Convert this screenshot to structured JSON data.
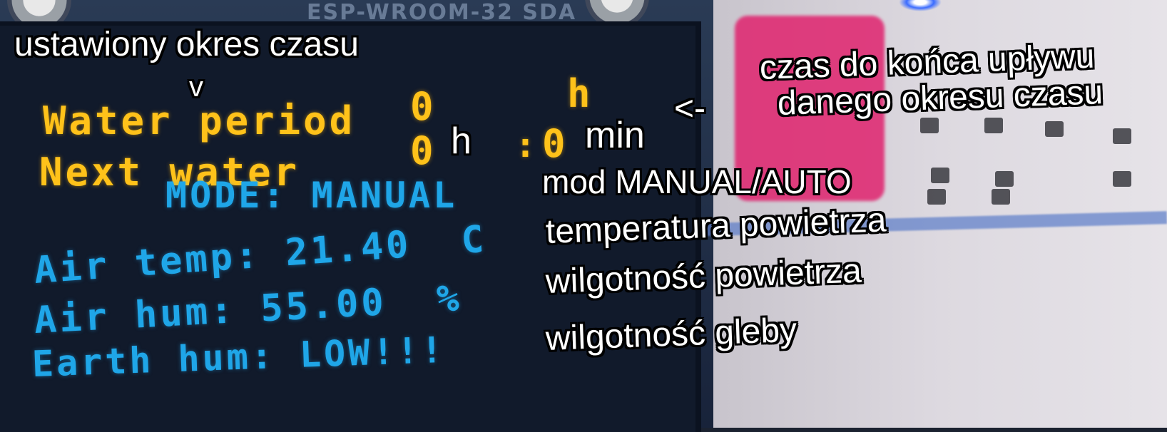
{
  "board": {
    "silkscreen": "ESP-WROOM-32 SDA"
  },
  "display": {
    "water_period_label": "Water period",
    "water_period_value": "0",
    "water_period_unit": "h",
    "next_water_label": "Next water",
    "next_water_hours": "0",
    "next_water_sep": ":",
    "next_water_minutes": "0",
    "mode_line": "MODE: MANUAL",
    "air_temp_line": "Air temp: 21.40  C",
    "air_hum_line": "Air hum: 55.00  %",
    "earth_hum_line": "Earth hum: LOW!!!"
  },
  "annotations": {
    "set_period": "ustawiony okres czasu",
    "down_arrow": "v",
    "hours_unit": "h",
    "minutes_unit": "min",
    "left_arrow": "<-",
    "time_left_line1": "czas do końca upływu",
    "time_left_line2": "danego okresu czasu",
    "mode": "mod MANUAL/AUTO",
    "air_temperature": "temperatura powietrza",
    "air_humidity": "wilgotność powietrza",
    "soil_humidity": "wilgotność gleby"
  }
}
